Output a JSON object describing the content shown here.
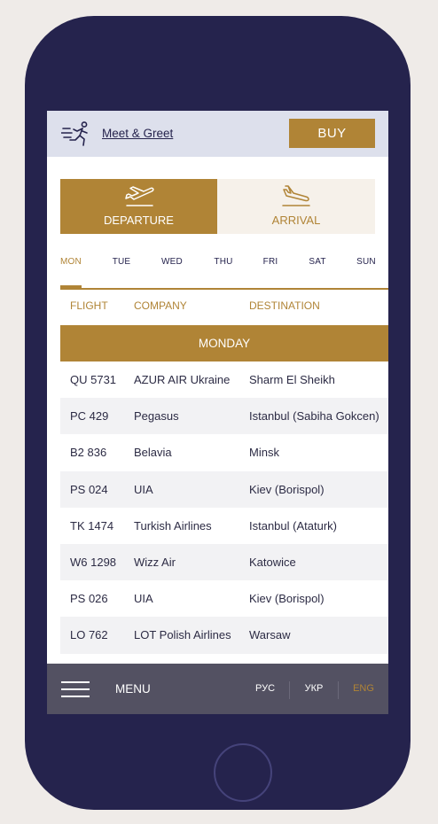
{
  "header": {
    "meet_label": "Meet & Greet",
    "buy_label": "BUY"
  },
  "modes": [
    {
      "label": "DEPARTURE",
      "icon": "plane-takeoff-icon",
      "active": true
    },
    {
      "label": "ARRIVAL",
      "icon": "plane-landing-icon",
      "active": false
    }
  ],
  "days": [
    "MON",
    "TUE",
    "WED",
    "THU",
    "FRI",
    "SAT",
    "SUN"
  ],
  "active_day": "MON",
  "table": {
    "headers": [
      "FLIGHT",
      "COMPANY",
      "DESTINATION"
    ],
    "day_label": "MONDAY",
    "rows": [
      {
        "flight": "QU 5731",
        "company": "AZUR AIR Ukraine",
        "destination": "Sharm El Sheikh"
      },
      {
        "flight": "PC 429",
        "company": "Pegasus",
        "destination": "Istanbul (Sabiha Gokcen)"
      },
      {
        "flight": "B2 836",
        "company": "Belavia",
        "destination": "Minsk"
      },
      {
        "flight": "PS 024",
        "company": "UIA",
        "destination": "Kiev (Borispol)"
      },
      {
        "flight": "TK 1474",
        "company": "Turkish Airlines",
        "destination": "Istanbul (Ataturk)"
      },
      {
        "flight": "W6 1298",
        "company": "Wizz Air",
        "destination": "Katowice"
      },
      {
        "flight": "PS 026",
        "company": "UIA",
        "destination": "Kiev (Borispol)"
      },
      {
        "flight": "LO 762",
        "company": "LOT Polish Airlines",
        "destination": "Warsaw"
      }
    ]
  },
  "menu": {
    "label": "MENU",
    "languages": [
      "РУС",
      "УКР",
      "ENG"
    ],
    "active_language": "ENG"
  },
  "colors": {
    "accent": "#b08436",
    "navy": "#25234d",
    "menubar": "#535162",
    "header_bg": "#dde0ec"
  }
}
